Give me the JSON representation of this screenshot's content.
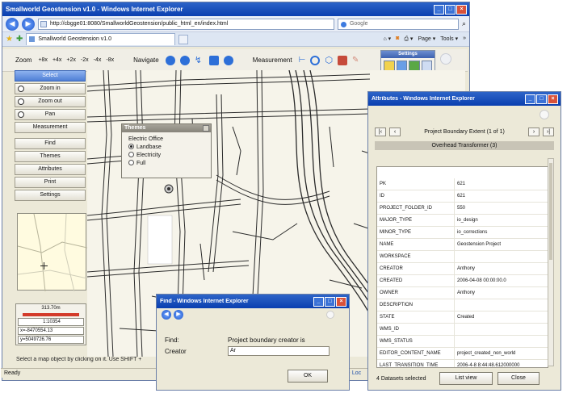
{
  "main_window": {
    "title": "Smallworld Geostension v1.0 - Windows Internet Explorer",
    "url": "http://cbgge01:8080/SmallworldGeostension/public_html_en/index.html",
    "search_placeholder": "Google",
    "tab_label": "Smallworld Geostension v1.0",
    "page_menu": "Page",
    "tools_menu": "Tools"
  },
  "toolbar": {
    "zoom_label": "Zoom",
    "zoom_options": [
      "+8x",
      "+4x",
      "+2x",
      "-2x",
      "-4x",
      "-8x"
    ],
    "navigate_label": "Navigate",
    "measurement_label": "Measurement"
  },
  "settings_panel": {
    "title": "Settings"
  },
  "left_panel": {
    "buttons": [
      "Select",
      "Zoom in",
      "Zoom out",
      "Pan",
      "Measurement",
      "Find",
      "Themes",
      "Attributes",
      "Print",
      "Settings"
    ]
  },
  "scale_info": {
    "distance": "313.70m",
    "ratio": "1:10354",
    "x": "x=-8470554.13",
    "y": "y=5049726.76"
  },
  "status": {
    "hint": "Select a map object by clicking on it. Use SHIFT +",
    "ready": "Ready",
    "zone": "Loc"
  },
  "themes_popup": {
    "title": "Themes",
    "group": "Electric Office",
    "options": [
      "Landbase",
      "Electricity",
      "Full"
    ],
    "selected": "Landbase"
  },
  "attributes_window": {
    "title": "Attributes - Windows Internet Explorer",
    "record_title": "Project Boundary Extent (1 of 1)",
    "record_sub": "Overhead Transformer (3)",
    "rows": [
      {
        "k": "PK",
        "v": "621"
      },
      {
        "k": "ID",
        "v": "621"
      },
      {
        "k": "PROJECT_FOLDER_ID",
        "v": "550"
      },
      {
        "k": "MAJOR_TYPE",
        "v": "io_design"
      },
      {
        "k": "MINOR_TYPE",
        "v": "io_corrections"
      },
      {
        "k": "NAME",
        "v": "Geostension Project"
      },
      {
        "k": "WORKSPACE",
        "v": ""
      },
      {
        "k": "CREATOR",
        "v": "Anthony"
      },
      {
        "k": "CREATED",
        "v": "2006-04-08 00:00:00.0"
      },
      {
        "k": "OWNER",
        "v": "Anthony"
      },
      {
        "k": "DESCRIPTION",
        "v": ""
      },
      {
        "k": "STATE",
        "v": "Created"
      },
      {
        "k": "WMS_ID",
        "v": ""
      },
      {
        "k": "WMS_STATUS",
        "v": ""
      },
      {
        "k": "EDITOR_CONTENT_NAME",
        "v": "project_created_non_world"
      },
      {
        "k": "LAST_TRANSITION_TIME",
        "v": "2006-4-8 8:44:48.612000000"
      }
    ],
    "datasets_count": "4 Datasets selected",
    "list_view_label": "List view",
    "close_label": "Close"
  },
  "find_window": {
    "title": "Find - Windows Internet Explorer",
    "find_label": "Find:",
    "find_value": "Project boundary creator is",
    "creator_label": "Creator",
    "creator_value": "Ar",
    "ok_label": "OK"
  }
}
